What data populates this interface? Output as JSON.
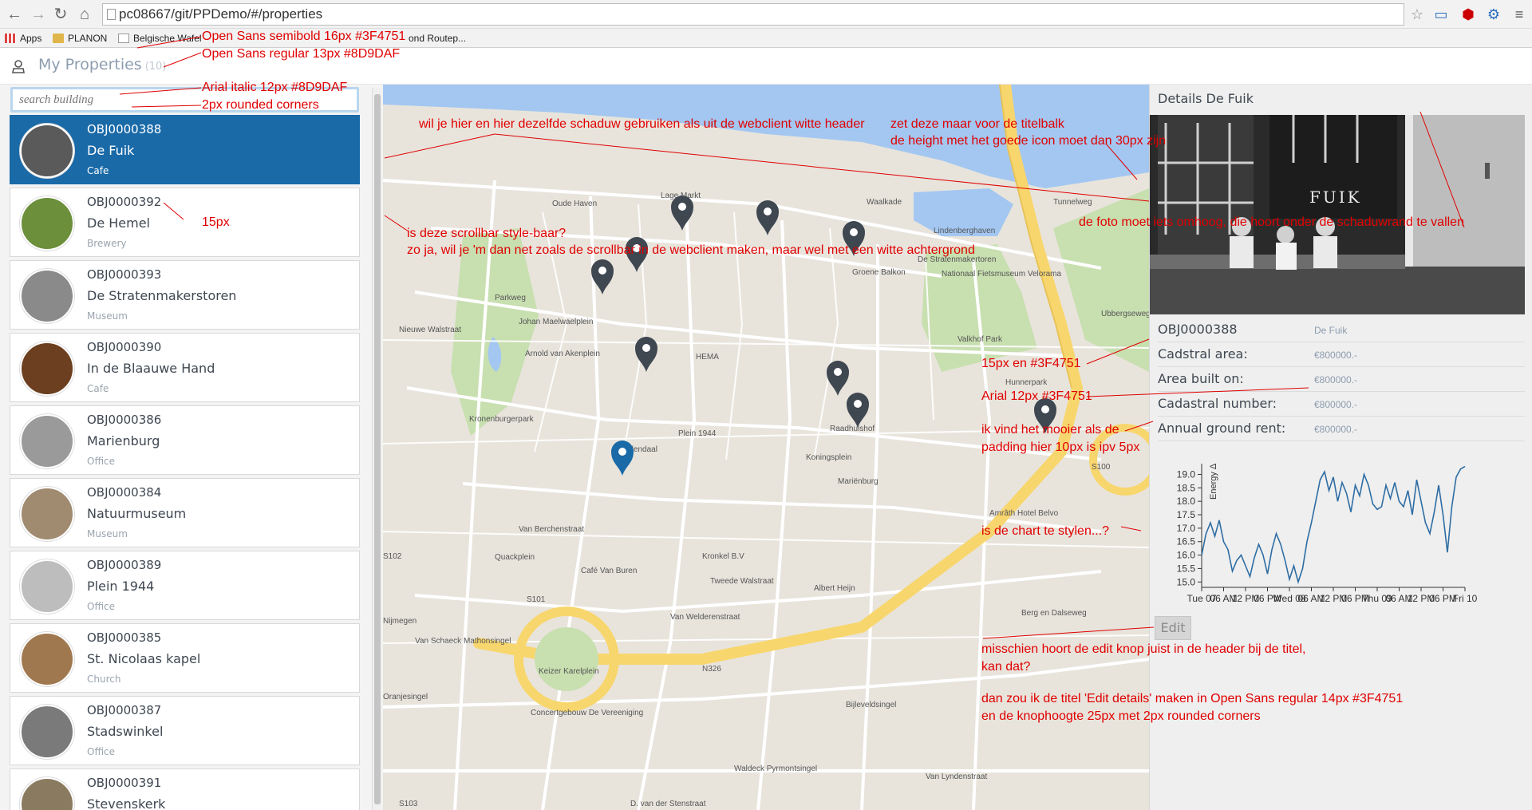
{
  "browser": {
    "url": "pc08667/git/PPDemo/#/properties",
    "bookmarks": [
      "Apps",
      "PLANON",
      "Belgische Wafel",
      "ond Routep..."
    ]
  },
  "header": {
    "title": "My Properties",
    "count": "(10)"
  },
  "search": {
    "placeholder": "search building"
  },
  "properties": [
    {
      "code": "OBJ0000388",
      "name": "De Fuik",
      "type": "Cafe",
      "selected": true
    },
    {
      "code": "OBJ0000392",
      "name": "De Hemel",
      "type": "Brewery",
      "selected": false
    },
    {
      "code": "OBJ0000393",
      "name": "De Stratenmakerstoren",
      "type": "Museum",
      "selected": false
    },
    {
      "code": "OBJ0000390",
      "name": "In de Blaauwe Hand",
      "type": "Cafe",
      "selected": false
    },
    {
      "code": "OBJ0000386",
      "name": "Marienburg",
      "type": "Office",
      "selected": false
    },
    {
      "code": "OBJ0000384",
      "name": "Natuurmuseum",
      "type": "Museum",
      "selected": false
    },
    {
      "code": "OBJ0000389",
      "name": "Plein 1944",
      "type": "Office",
      "selected": false
    },
    {
      "code": "OBJ0000385",
      "name": "St. Nicolaas kapel",
      "type": "Church",
      "selected": false
    },
    {
      "code": "OBJ0000387",
      "name": "Stadswinkel",
      "type": "Office",
      "selected": false
    },
    {
      "code": "OBJ0000391",
      "name": "Stevenskerk",
      "type": "",
      "selected": false
    }
  ],
  "map": {
    "labels": [
      "Oude Haven",
      "Lage Markt",
      "Waalkade",
      "Lindenberghaven",
      "De Stratenmakertoren",
      "Nationaal Fietsmuseum Velorama",
      "Groene Balkon",
      "Valkhof Park",
      "Hunnerpark",
      "Kronenburgerpark",
      "HEMA",
      "Plein 1944",
      "Raadhuishof",
      "Koningsplein",
      "Mariënburg",
      "Café Van Buren",
      "Kronkel B.V",
      "Albert Heijn",
      "Tweede Walstraat",
      "Van Welderenstraat",
      "Berg en Dalseweg",
      "Keizer Karelplein",
      "Van Schaeck Mathonsingel",
      "Oranjesingel",
      "Bijleveldsingel",
      "Concertgebouw De Vereeniging",
      "Amrâth Hotel Belvo",
      "Nijmegen",
      "Quackplein",
      "Van Berchenstraat",
      "Van Lyndenstraat",
      "Waldeck Pyrmontsingel",
      "N326",
      "S100",
      "S101",
      "S102",
      "S103",
      "Nieuwe Walstraat",
      "Tunnelweg",
      "Doddendaal",
      "Johan Maelwaelplein",
      "Arnold van Akenplein",
      "Parkweg",
      "Ubbergseweg",
      "D. van der Stenstraat"
    ]
  },
  "details": {
    "title": "Details De Fuik",
    "photo_sign": "FUIK",
    "code": "OBJ0000388",
    "code_value": "De Fuik",
    "rows": [
      {
        "label": "Cadstral area:",
        "value": "€800000.-"
      },
      {
        "label": "Area built on:",
        "value": "€800000.-"
      },
      {
        "label": "Cadastral number:",
        "value": "€800000.-"
      },
      {
        "label": "Annual ground rent:",
        "value": "€800000.-"
      }
    ],
    "edit_label": "Edit"
  },
  "chart_data": {
    "type": "line",
    "ylabel": "Energy Δ",
    "ylim": [
      14.8,
      19.4
    ],
    "yticks": [
      15.0,
      15.5,
      16.0,
      16.5,
      17.0,
      17.5,
      18.0,
      18.5,
      19.0
    ],
    "xticklabels": [
      "Tue 07",
      "06 AM",
      "12 PM",
      "06 PM",
      "Wed 08",
      "06 AM",
      "12 PM",
      "06 PM",
      "Thu 09",
      "06 AM",
      "12 PM",
      "06 PM",
      "Fri 10"
    ],
    "x": [
      0,
      1,
      2,
      3,
      4,
      5,
      6,
      7,
      8,
      9,
      10,
      11,
      12,
      13,
      14,
      15,
      16,
      17,
      18,
      19,
      20,
      21,
      22,
      23,
      24,
      25,
      26,
      27,
      28,
      29,
      30,
      31,
      32,
      33,
      34,
      35,
      36,
      37,
      38,
      39,
      40,
      41,
      42,
      43,
      44,
      45,
      46,
      47,
      48,
      49,
      50,
      51,
      52,
      53,
      54,
      55,
      56,
      57,
      58,
      59,
      60
    ],
    "values": [
      16.0,
      16.8,
      17.2,
      16.7,
      17.3,
      16.5,
      16.2,
      15.4,
      15.8,
      16.0,
      15.6,
      15.2,
      15.9,
      16.4,
      16.0,
      15.3,
      16.2,
      16.8,
      16.4,
      15.8,
      15.1,
      15.6,
      15.0,
      15.5,
      16.5,
      17.2,
      18.0,
      18.8,
      19.1,
      18.4,
      18.9,
      18.0,
      18.7,
      18.3,
      17.6,
      18.6,
      18.2,
      19.0,
      18.6,
      17.9,
      17.7,
      17.8,
      18.6,
      18.1,
      18.7,
      18.0,
      17.8,
      18.4,
      17.5,
      18.8,
      18.0,
      17.2,
      16.8,
      17.6,
      18.6,
      17.5,
      16.1,
      17.8,
      18.9,
      19.2,
      19.3
    ],
    "color": "#2e6da4"
  },
  "annotations": [
    "Open Sans semibold 16px #3F4751",
    "Open Sans regular 13px #8D9DAF",
    "Arial italic 12px #8D9DAF",
    "2px rounded corners",
    "15px",
    "wil je hier en hier dezelfde schaduw gebruiken als uit de webclient witte header",
    "zet deze maar voor de titelbalk",
    "de height met het goede  icon moet dan 30px zijn",
    "de foto moet iets omhoog, die hoort onder de schaduwrand te vallen",
    "is deze scrollbar style-baar?",
    "zo ja, wil je 'm dan net zoals de scrollbar in de webclient maken, maar wel met een witte achtergrond",
    "15px en #3F4751",
    "Arial 12px #3F4751",
    "ik vind het mooier als de",
    "padding hier 10px is ipv 5px",
    "is de chart te stylen...?",
    "misschien hoort de edit knop juist in de header bij de titel,",
    "kan dat?",
    "dan zou ik de titel 'Edit details' maken in Open Sans regular 14px #3F4751",
    "en de knophoogte 25px met 2px rounded corners"
  ],
  "colors": {
    "selected_bg": "#1a6aa8",
    "annotation": "#e00000",
    "water": "#a3c7f1",
    "park": "#c8dfb0",
    "highway": "#f8d66e"
  }
}
